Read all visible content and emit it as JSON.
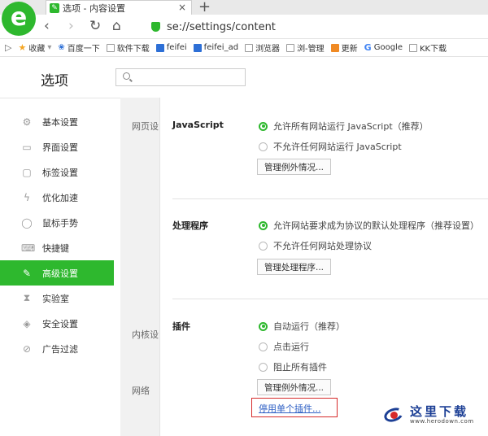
{
  "browser": {
    "tab_title": "选项 - 内容设置",
    "tab_close": "×",
    "new_tab": "+",
    "url": "se://settings/content",
    "logo_letter": "e"
  },
  "nav": {
    "back": "‹",
    "forward": "›",
    "reload": "↻",
    "home": "⌂"
  },
  "bookmarks": [
    {
      "label": "收藏",
      "icon": "star-icon"
    },
    {
      "label": "百度一下",
      "icon": "baidu-paw-icon"
    },
    {
      "label": "软件下载",
      "icon": "page-icon"
    },
    {
      "label": "feifei",
      "icon": "blue-square-icon"
    },
    {
      "label": "feifei_ad",
      "icon": "blue-square-icon"
    },
    {
      "label": "浏览器",
      "icon": "page-icon"
    },
    {
      "label": "浏-管理",
      "icon": "page-icon"
    },
    {
      "label": "更新",
      "icon": "orange-square-icon"
    },
    {
      "label": "Google",
      "icon": "google-icon"
    },
    {
      "label": "KK下载",
      "icon": "page-icon"
    }
  ],
  "settings": {
    "title": "选项",
    "search_placeholder": ""
  },
  "sidebar": {
    "items": [
      {
        "label": "基本设置",
        "icon": "gear-icon",
        "glyph": "⚙"
      },
      {
        "label": "界面设置",
        "icon": "window-icon",
        "glyph": "▭"
      },
      {
        "label": "标签设置",
        "icon": "tab-icon",
        "glyph": "▢"
      },
      {
        "label": "优化加速",
        "icon": "lightning-icon",
        "glyph": "ϟ"
      },
      {
        "label": "鼠标手势",
        "icon": "mouse-icon",
        "glyph": "◯"
      },
      {
        "label": "快捷键",
        "icon": "keyboard-icon",
        "glyph": "⌨"
      },
      {
        "label": "高级设置",
        "icon": "wrench-icon",
        "glyph": "✎"
      },
      {
        "label": "实验室",
        "icon": "hourglass-icon",
        "glyph": "⧗"
      },
      {
        "label": "安全设置",
        "icon": "shield-icon",
        "glyph": "◈"
      },
      {
        "label": "广告过滤",
        "icon": "block-icon",
        "glyph": "⊘"
      }
    ],
    "active_index": 6
  },
  "sections": {
    "web": "网页设",
    "core": "内核设",
    "network": "网络"
  },
  "javascript": {
    "heading": "JavaScript",
    "options": [
      "允许所有网站运行 JavaScript（推荐）",
      "不允许任何网站运行 JavaScript"
    ],
    "selected": 0,
    "button": "管理例外情况..."
  },
  "handlers": {
    "heading": "处理程序",
    "options": [
      "允许网站要求成为协议的默认处理程序（推荐设置）",
      "不允许任何网站处理协议"
    ],
    "selected": 0,
    "button": "管理处理程序..."
  },
  "plugins": {
    "heading": "插件",
    "options": [
      "自动运行（推荐）",
      "点击运行",
      "阻止所有插件"
    ],
    "selected": 0,
    "button": "管理例外情况...",
    "link": "停用单个插件..."
  },
  "watermark": {
    "text": "这里下载",
    "url": "www.herodown.com"
  },
  "colors": {
    "accent": "#2eb82e",
    "link": "#2d5fc4",
    "highlight_box": "#d62a2a"
  }
}
